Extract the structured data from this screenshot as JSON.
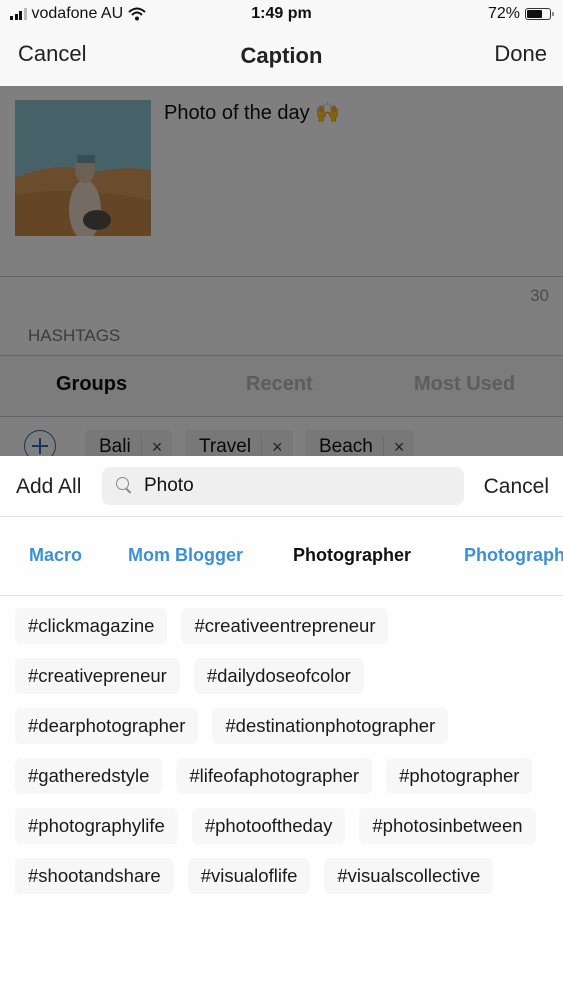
{
  "status_bar": {
    "carrier": "vodafone AU",
    "time": "1:49 pm",
    "battery_percent": "72%",
    "battery_level": 0.72,
    "icons": [
      "signal-icon",
      "wifi-icon",
      "battery-icon"
    ]
  },
  "nav": {
    "cancel_label": "Cancel",
    "title": "Caption",
    "done_label": "Done"
  },
  "caption": {
    "text": "Photo of the day 🙌",
    "thumbnail_alt": "Woman in headscarf on desert dunes"
  },
  "character_count": "30",
  "hashtags_section": {
    "label": "HASHTAGS",
    "tabs": [
      {
        "label": "Groups",
        "active": true
      },
      {
        "label": "Recent",
        "active": false
      },
      {
        "label": "Most Used",
        "active": false
      }
    ],
    "groups": [
      {
        "label": "Bali"
      },
      {
        "label": "Travel"
      },
      {
        "label": "Beach"
      }
    ],
    "remove_symbol": "×"
  },
  "search_sheet": {
    "add_all_label": "Add All",
    "search_value": "Photo",
    "search_placeholder": "Search",
    "cancel_label": "Cancel",
    "categories": [
      {
        "label": "Macro",
        "active": false
      },
      {
        "label": "Mom Blogger",
        "active": false
      },
      {
        "label": "Photographer",
        "active": true
      },
      {
        "label": "Photographer",
        "active": false
      }
    ],
    "tags": [
      "#clickmagazine",
      "#creativeentrepreneur",
      "#creativepreneur",
      "#dailydoseofcolor",
      "#dearphotographer",
      "#destinationphotographer",
      "#gatheredstyle",
      "#lifeofaphotographer",
      "#photographer",
      "#photographylife",
      "#photooftheday",
      "#photosinbetween",
      "#shootandshare",
      "#visualoflife",
      "#visualscollective"
    ]
  },
  "colors": {
    "accent_blue": "#3d8fd6",
    "plus_blue": "#2f6fb5",
    "dim_overlay": "rgba(0,0,0,0.5)"
  }
}
